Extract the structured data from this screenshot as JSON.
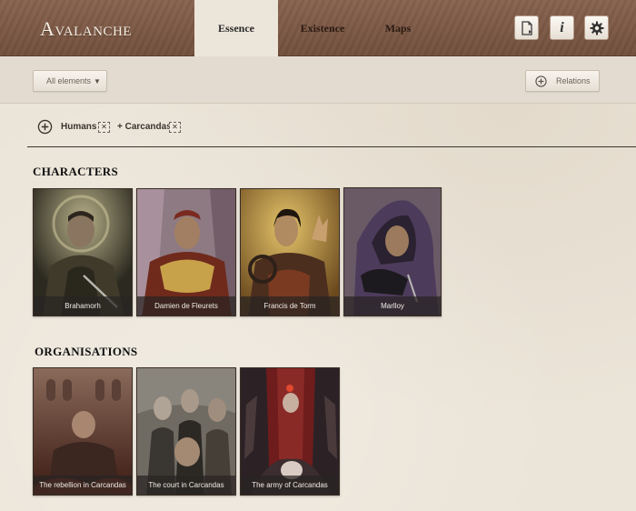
{
  "app": {
    "logo": "Avalanche"
  },
  "tabs": [
    {
      "label": "Essence",
      "active": true
    },
    {
      "label": "Existence",
      "active": false
    },
    {
      "label": "Maps",
      "active": false
    }
  ],
  "header_buttons": {
    "doc_icon": "document-icon",
    "info_icon": "info-icon",
    "settings_icon": "gear-icon",
    "info_glyph": "i"
  },
  "toolbar": {
    "filter_dropdown": {
      "label": "All elements",
      "caret": "▼"
    },
    "relations_button": {
      "label": "Relations"
    }
  },
  "filters": {
    "chips": [
      {
        "label": "Humans",
        "remove": "✕"
      },
      {
        "label": "+ Carcandas",
        "remove": "✕"
      }
    ]
  },
  "sections": {
    "characters": {
      "title": "CHARACTERS",
      "items": [
        {
          "name": "Brahamorh"
        },
        {
          "name": "Damien de Fleurets"
        },
        {
          "name": "Francis de Torm"
        },
        {
          "name": "Marlloy"
        }
      ]
    },
    "organisations": {
      "title": "ORGANISATIONS",
      "items": [
        {
          "name": "The rebellion in Carcandas"
        },
        {
          "name": "The court in Carcandas"
        },
        {
          "name": "The army of Carcandas"
        }
      ]
    }
  },
  "colors": {
    "header_bg": "#7f5843",
    "page_bg": "#ebe4d8",
    "toolbar_bg": "#e3dbcf",
    "caption_bg": "#2e2a28"
  }
}
